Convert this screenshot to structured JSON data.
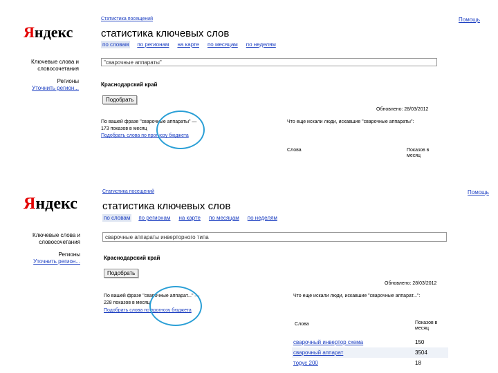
{
  "top": {
    "breadcrumb": "Статистика посещений",
    "help": "Помощь",
    "logo_y": "Я",
    "logo_rest": "ндекс",
    "title": "статистика ключевых слов",
    "tabs": [
      "по словам",
      "по регионам",
      "на карте",
      "по месяцам",
      "по неделям"
    ],
    "side_keywords": "Ключевые слова и словосочетания",
    "side_regions": "Регионы",
    "side_specify": "Уточнить регион...",
    "query": "\"сварочные аппараты\"",
    "region": "Краснодарский край",
    "submit": "Подобрать",
    "updated": "Обновлено: 28/03/2012",
    "result_left": "По вашей фразе \"сварочные аппараты\" — 173 показов в месяц",
    "result_link": "Подобрать слова по прогнозу бюджета",
    "result_right": "Что еще искали люди, искавшие \"сварочные аппараты\":",
    "col_words": "Слова",
    "col_shows": "Показов в месяц"
  },
  "bottom": {
    "breadcrumb": "Статистика посещений",
    "help": "Помощь",
    "logo_y": "Я",
    "logo_rest": "ндекс",
    "title": "статистика ключевых слов",
    "tabs": [
      "по словам",
      "по регионам",
      "на карте",
      "по месяцам",
      "по неделям"
    ],
    "side_keywords": "Ключевые слова и словосочетания",
    "side_regions": "Регионы",
    "side_specify": "Уточнить регион...",
    "query": "сварочные аппараты инверторного типа",
    "region": "Краснодарский край",
    "submit": "Подобрать",
    "updated": "Обновлено: 28/03/2012",
    "result_left": "По вашей фразе \"сварочные аппарат...\" — 228 показов в месяц",
    "result_link": "Подобрать слова по прогнозу бюджета",
    "result_right": "Что еще искали люди, искавшие \"сварочные аппарат...\":",
    "col_words": "Слова",
    "col_shows": "Показов в месяц",
    "rows": [
      {
        "word": "сварочный инвертор схема",
        "count": "150"
      },
      {
        "word": "сварочный аппарат",
        "count": "3504"
      },
      {
        "word": "торус 200",
        "count": "18"
      }
    ]
  },
  "colors": {
    "accent": "#2a9fd6",
    "link": "#1a3dc1",
    "logo_red": "#e30000"
  }
}
